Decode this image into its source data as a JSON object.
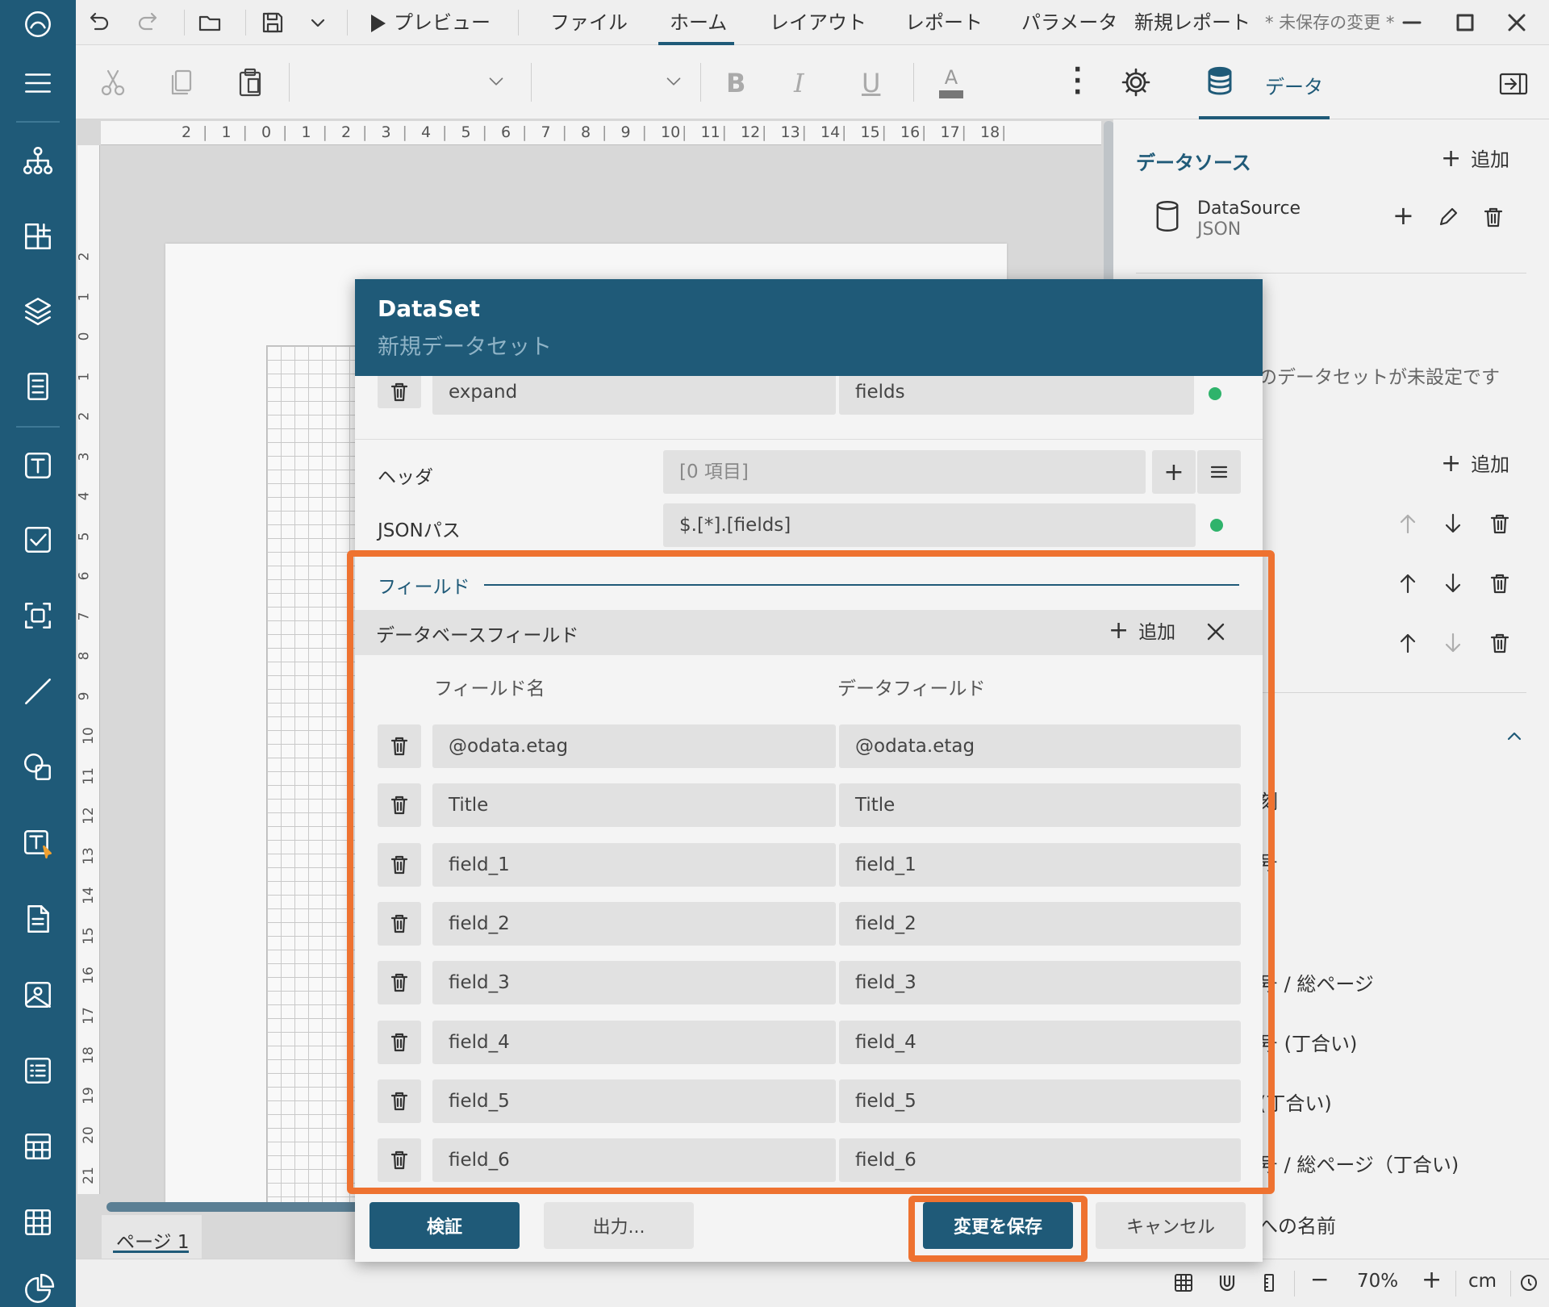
{
  "colors": {
    "brand": "#1f5a78",
    "accent": "#ee7230",
    "ok": "#2fb36b"
  },
  "titlebar": {
    "preview": "プレビュー",
    "menus": [
      "ファイル",
      "ホーム",
      "レイアウト",
      "レポート",
      "パラメータ"
    ],
    "active_menu": "ホーム",
    "doc_title": "新規レポート",
    "unsaved": "* 未保存の変更 *"
  },
  "toolbar": {
    "data_tab": "データ"
  },
  "ruler": {
    "h": [
      "2",
      "1",
      "0",
      "1",
      "2",
      "3",
      "4",
      "5",
      "6",
      "7",
      "8",
      "9",
      "10",
      "11",
      "12",
      "13",
      "14",
      "15",
      "16",
      "17",
      "18"
    ],
    "v": [
      "2",
      "1",
      "0",
      "1",
      "2",
      "3",
      "4",
      "5",
      "6",
      "7",
      "8",
      "9",
      "10",
      "11",
      "12",
      "13",
      "14",
      "15",
      "16",
      "17",
      "18",
      "19",
      "20",
      "21"
    ]
  },
  "page_tab": "ページ 1",
  "right_panel": {
    "datasource_title": "データソース",
    "add": "追加",
    "ds_name": "DataSource",
    "ds_type": "JSON",
    "no_dataset": "のデータセットが未設定です",
    "add2": "追加",
    "list": [
      "刻",
      "号",
      "",
      "号 / 総ページ",
      "号 (丁合い)",
      "(丁合い)",
      "号 / 総ページ（丁合い)",
      "への名前"
    ]
  },
  "status": {
    "zoom": "70%",
    "unit": "cm"
  },
  "dialog": {
    "title": "DataSet",
    "subtitle": "新規データセット",
    "expand_row": {
      "name": "expand",
      "value": "fields"
    },
    "header_label": "ヘッダ",
    "header_value": "[0 項目]",
    "jsonpath_label": "JSONパス",
    "jsonpath_value": "$.[*].[fields]",
    "fields_section": "フィールド",
    "db_fields": "データベースフィールド",
    "add": "追加",
    "col_name": "フィールド名",
    "col_data": "データフィールド",
    "rows": [
      {
        "name": "@odata.etag",
        "data": "@odata.etag"
      },
      {
        "name": "Title",
        "data": "Title"
      },
      {
        "name": "field_1",
        "data": "field_1"
      },
      {
        "name": "field_2",
        "data": "field_2"
      },
      {
        "name": "field_3",
        "data": "field_3"
      },
      {
        "name": "field_4",
        "data": "field_4"
      },
      {
        "name": "field_5",
        "data": "field_5"
      },
      {
        "name": "field_6",
        "data": "field_6"
      }
    ],
    "validate": "検証",
    "export": "出力...",
    "save": "変更を保存",
    "cancel": "キャンセル"
  }
}
